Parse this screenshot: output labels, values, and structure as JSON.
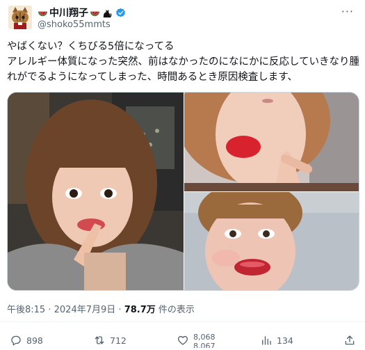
{
  "author": {
    "display_name": "中川翔子",
    "handle": "@shoko55mmts",
    "avatar_icon": "cat-avatar-icon",
    "name_emoji_left": "watermelon-icon",
    "name_emoji_right": "watermelon-icon",
    "name_emoji_cat": "black-cat-icon",
    "verified_color": "#1d9bf0"
  },
  "post": {
    "text": "やばくない？くちびる5倍になってる\nアレルギー体質になった突然、前はなかったのになにかに反応していきなり腫れがでるようになってしまった、時間あるとき原因検査します、"
  },
  "media": [
    {
      "name": "selfie-pointing-lips"
    },
    {
      "name": "selfie-finger-on-lip"
    },
    {
      "name": "selfie-swollen-lips"
    }
  ],
  "meta": {
    "time": "午後8:15",
    "separator": "·",
    "date": "2024年7月9日",
    "views_count": "78.7万",
    "views_label": "件の表示"
  },
  "actions": {
    "replies": "898",
    "reposts": "712",
    "likes_top": "8,068",
    "likes_bottom": "8,067",
    "bookmarks": "134"
  },
  "colors": {
    "text": "#0f1419",
    "secondary": "#536471",
    "border": "#cfd9de"
  }
}
